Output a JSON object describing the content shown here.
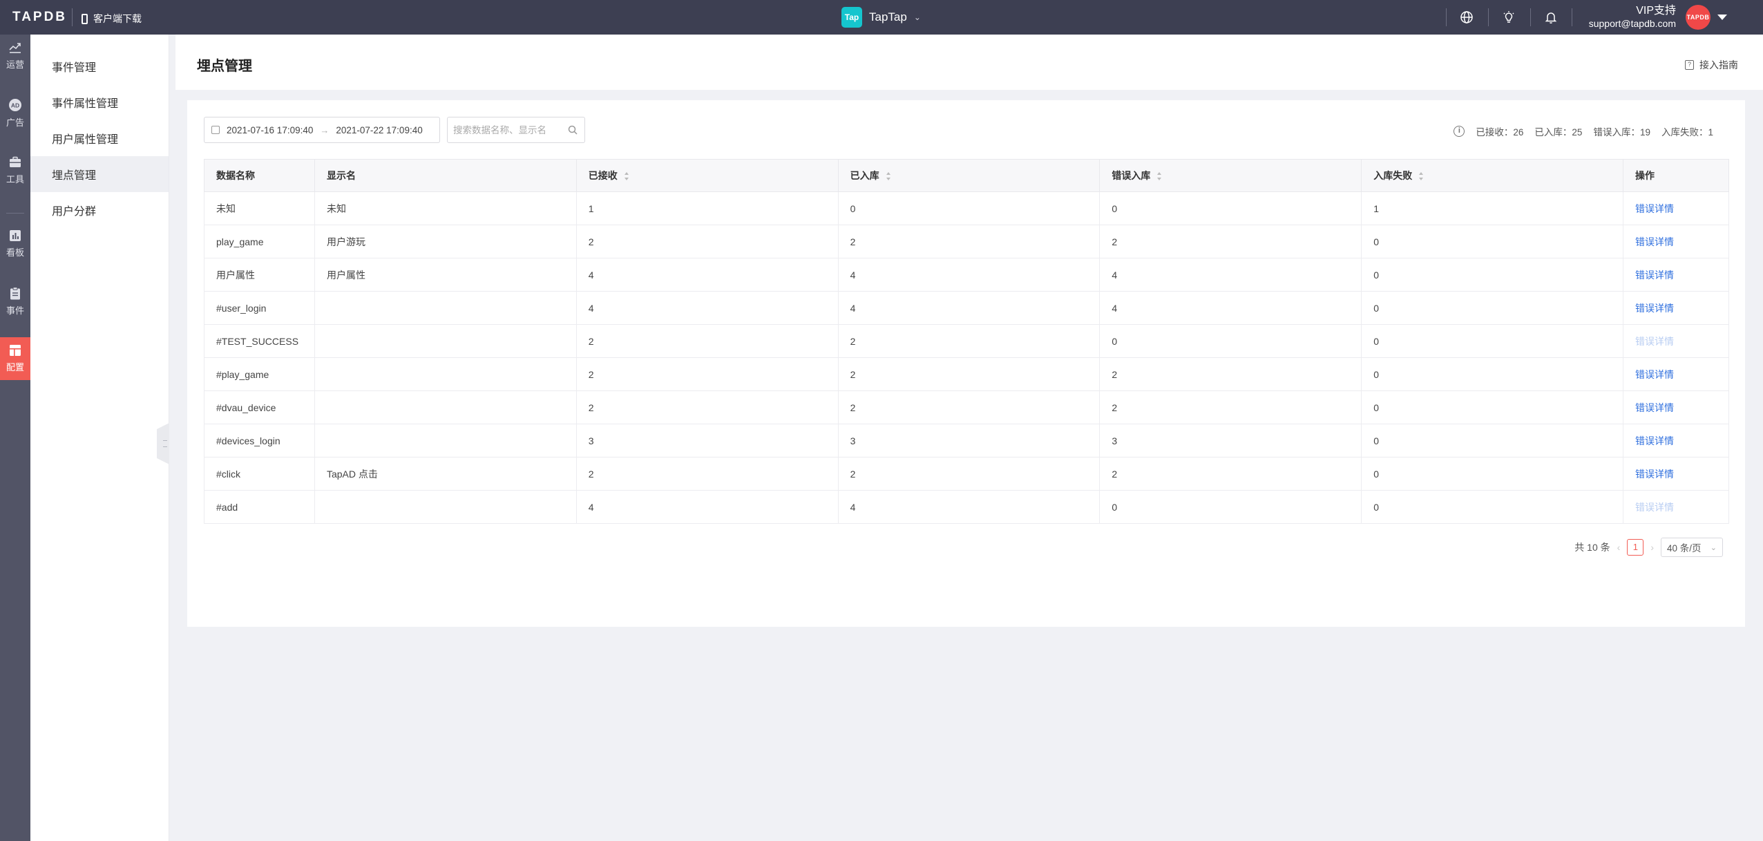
{
  "topbar": {
    "logo": "TAPDB",
    "client_download": "客户端下载",
    "app_badge": "Tap",
    "app_name": "TapTap",
    "vip_label": "VIP支持",
    "support_email": "support@tapdb.com",
    "avatar_text": "TAPDB"
  },
  "rail": [
    {
      "label": "运营",
      "icon": "chart-up-icon"
    },
    {
      "label": "广告",
      "icon": "ad-icon"
    },
    {
      "label": "工具",
      "icon": "toolbox-icon"
    },
    {
      "label": "看板",
      "icon": "dashboard-icon"
    },
    {
      "label": "事件",
      "icon": "clipboard-icon"
    },
    {
      "label": "配置",
      "icon": "layout-icon",
      "active": true
    }
  ],
  "subnav": [
    {
      "label": "事件管理"
    },
    {
      "label": "事件属性管理"
    },
    {
      "label": "用户属性管理"
    },
    {
      "label": "埋点管理",
      "active": true
    },
    {
      "label": "用户分群"
    }
  ],
  "page": {
    "title": "埋点管理",
    "guide_label": "接入指南"
  },
  "filters": {
    "start_time": "2021-07-16 17:09:40",
    "end_time": "2021-07-22 17:09:40",
    "search_placeholder": "搜索数据名称、显示名",
    "search_value": ""
  },
  "stats": {
    "received": "已接收：26",
    "stored": "已入库：25",
    "error_stored": "错误入库：19",
    "failed": "入库失败：1"
  },
  "table": {
    "columns": [
      "数据名称",
      "显示名",
      "已接收",
      "已入库",
      "错误入库",
      "入库失败",
      "操作"
    ],
    "rows": [
      {
        "name": "未知",
        "display": "未知",
        "received": "1",
        "stored": "0",
        "error": "0",
        "failed": "1",
        "action": "错误详情",
        "enabled": true
      },
      {
        "name": "play_game",
        "display": "用户游玩",
        "received": "2",
        "stored": "2",
        "error": "2",
        "failed": "0",
        "action": "错误详情",
        "enabled": true
      },
      {
        "name": "用户属性",
        "display": "用户属性",
        "received": "4",
        "stored": "4",
        "error": "4",
        "failed": "0",
        "action": "错误详情",
        "enabled": true
      },
      {
        "name": "#user_login",
        "display": "",
        "received": "4",
        "stored": "4",
        "error": "4",
        "failed": "0",
        "action": "错误详情",
        "enabled": true
      },
      {
        "name": "#TEST_SUCCESS",
        "display": "",
        "received": "2",
        "stored": "2",
        "error": "0",
        "failed": "0",
        "action": "错误详情",
        "enabled": false
      },
      {
        "name": "#play_game",
        "display": "",
        "received": "2",
        "stored": "2",
        "error": "2",
        "failed": "0",
        "action": "错误详情",
        "enabled": true
      },
      {
        "name": "#dvau_device",
        "display": "",
        "received": "2",
        "stored": "2",
        "error": "2",
        "failed": "0",
        "action": "错误详情",
        "enabled": true
      },
      {
        "name": "#devices_login",
        "display": "",
        "received": "3",
        "stored": "3",
        "error": "3",
        "failed": "0",
        "action": "错误详情",
        "enabled": true
      },
      {
        "name": "#click",
        "display": "TapAD 点击",
        "received": "2",
        "stored": "2",
        "error": "2",
        "failed": "0",
        "action": "错误详情",
        "enabled": true
      },
      {
        "name": "#add",
        "display": "",
        "received": "4",
        "stored": "4",
        "error": "0",
        "failed": "0",
        "action": "错误详情",
        "enabled": false
      }
    ]
  },
  "pagination": {
    "total": "共 10 条",
    "current_page": "1",
    "page_size": "40 条/页"
  },
  "colors": {
    "accent": "#f25c54",
    "link": "#2f6fde",
    "topbar": "#3d3f52",
    "rail": "#525466"
  }
}
